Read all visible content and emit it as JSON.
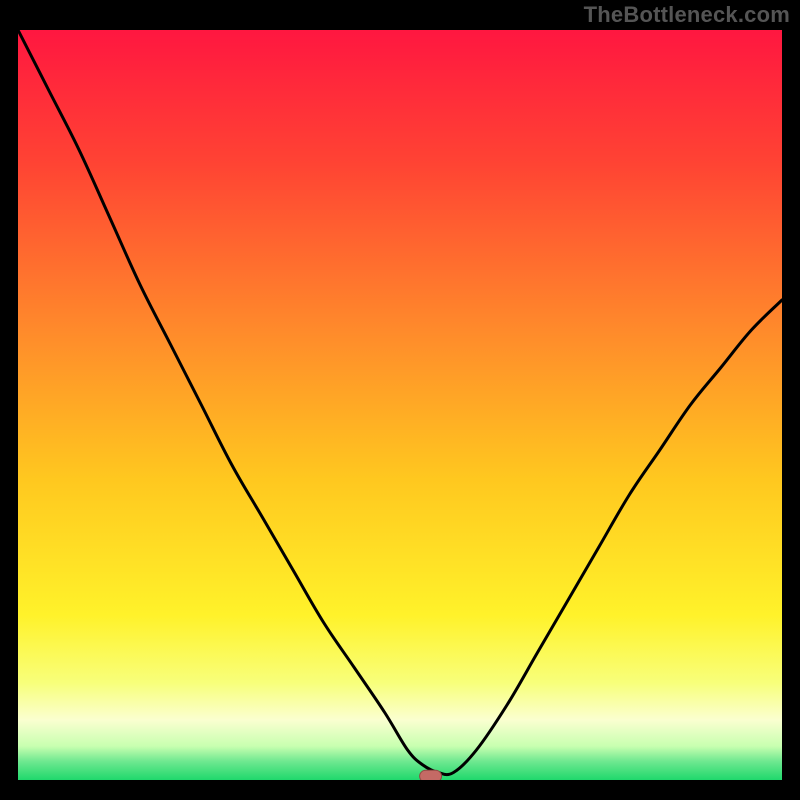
{
  "watermark": "TheBottleneck.com",
  "colors": {
    "frame": "#000000",
    "watermark": "#555555",
    "gradient_stops": [
      {
        "offset": 0.0,
        "color": "#ff1740"
      },
      {
        "offset": 0.18,
        "color": "#ff4433"
      },
      {
        "offset": 0.4,
        "color": "#ff8a2b"
      },
      {
        "offset": 0.6,
        "color": "#ffc81f"
      },
      {
        "offset": 0.78,
        "color": "#fff22a"
      },
      {
        "offset": 0.87,
        "color": "#f8ff7a"
      },
      {
        "offset": 0.92,
        "color": "#faffd0"
      },
      {
        "offset": 0.955,
        "color": "#c8ffb0"
      },
      {
        "offset": 0.975,
        "color": "#6fe890"
      },
      {
        "offset": 1.0,
        "color": "#1fd86c"
      }
    ],
    "curve_stroke": "#000000",
    "marker_fill": "#c46a65",
    "marker_stroke": "#8f4a44"
  },
  "chart_data": {
    "type": "line",
    "title": "",
    "xlabel": "",
    "ylabel": "",
    "xlim": [
      0,
      100
    ],
    "ylim": [
      0,
      100
    ],
    "series": [
      {
        "name": "bottleneck-curve",
        "x": [
          0,
          4,
          8,
          12,
          16,
          20,
          24,
          28,
          32,
          36,
          40,
          44,
          48,
          51,
          53,
          55,
          57,
          60,
          64,
          68,
          72,
          76,
          80,
          84,
          88,
          92,
          96,
          100
        ],
        "y": [
          100,
          92,
          84,
          75,
          66,
          58,
          50,
          42,
          35,
          28,
          21,
          15,
          9,
          4,
          2,
          1,
          1,
          4,
          10,
          17,
          24,
          31,
          38,
          44,
          50,
          55,
          60,
          64
        ]
      }
    ],
    "flat_zone_x": [
      51,
      57
    ],
    "marker": {
      "x": 54,
      "y": 0.5,
      "label": "optimal-point"
    }
  }
}
